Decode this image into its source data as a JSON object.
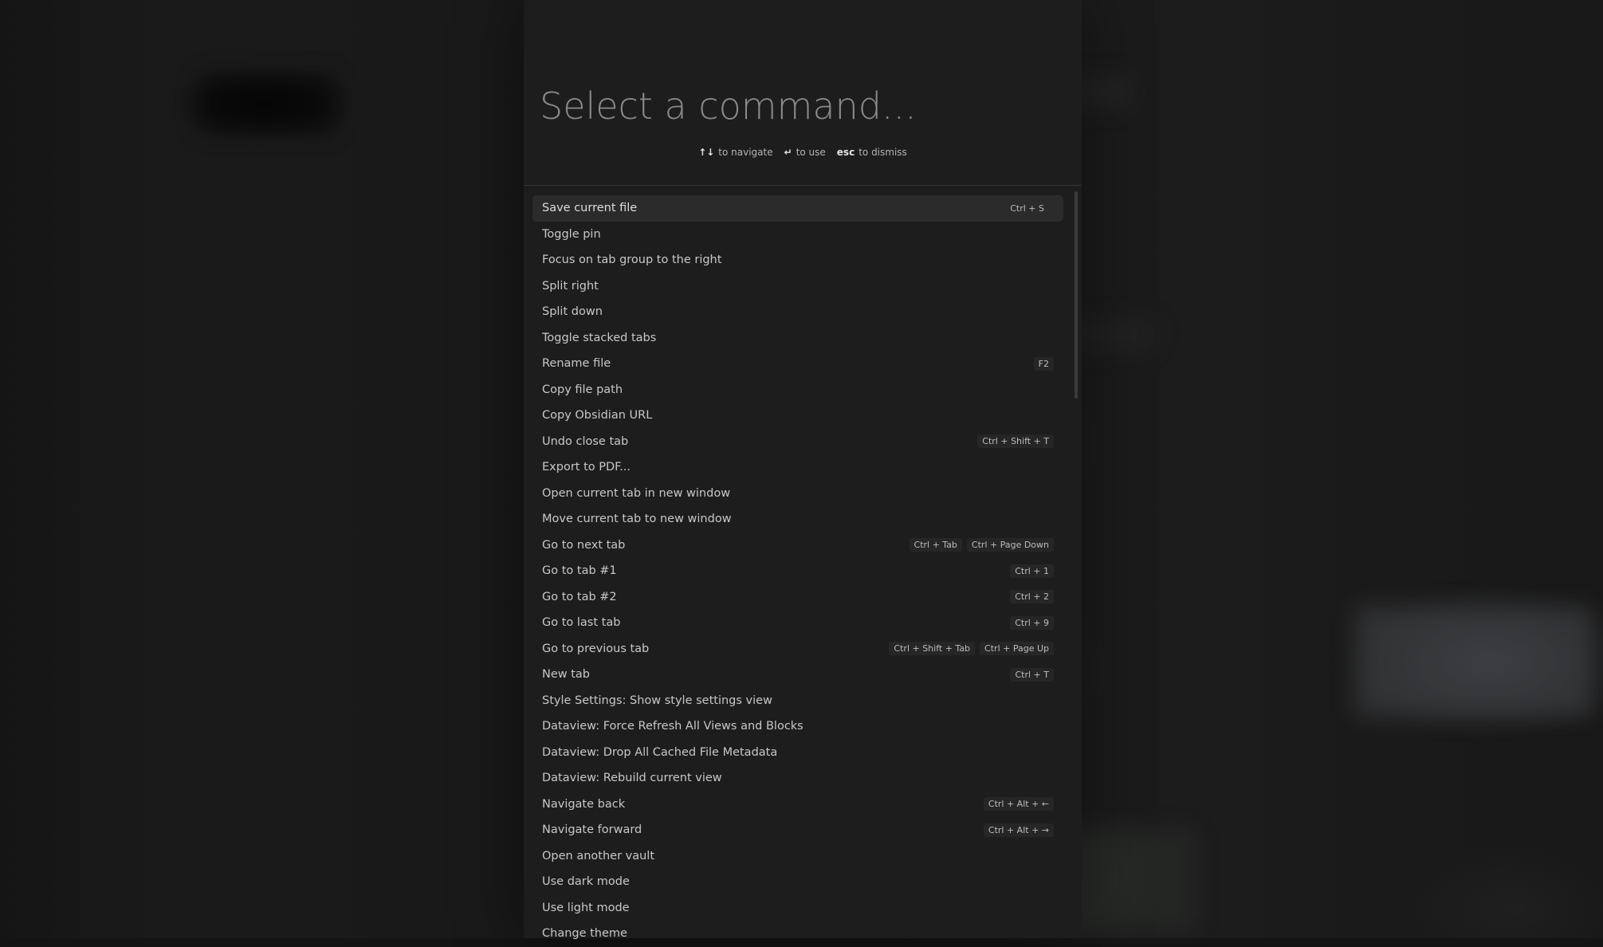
{
  "prompt": {
    "placeholder": "Select a command...",
    "value": ""
  },
  "instructions": [
    {
      "key": "↑↓",
      "text": "to navigate"
    },
    {
      "key": "↵",
      "text": "to use"
    },
    {
      "key": "esc",
      "text": "to dismiss"
    }
  ],
  "commands": [
    {
      "label": "Save current file",
      "hotkeys": [
        "Ctrl + S"
      ],
      "selected": true
    },
    {
      "label": "Toggle pin",
      "hotkeys": []
    },
    {
      "label": "Focus on tab group to the right",
      "hotkeys": []
    },
    {
      "label": "Split right",
      "hotkeys": []
    },
    {
      "label": "Split down",
      "hotkeys": []
    },
    {
      "label": "Toggle stacked tabs",
      "hotkeys": []
    },
    {
      "label": "Rename file",
      "hotkeys": [
        "F2"
      ]
    },
    {
      "label": "Copy file path",
      "hotkeys": []
    },
    {
      "label": "Copy Obsidian URL",
      "hotkeys": []
    },
    {
      "label": "Undo close tab",
      "hotkeys": [
        "Ctrl + Shift + T"
      ]
    },
    {
      "label": "Export to PDF...",
      "hotkeys": []
    },
    {
      "label": "Open current tab in new window",
      "hotkeys": []
    },
    {
      "label": "Move current tab to new window",
      "hotkeys": []
    },
    {
      "label": "Go to next tab",
      "hotkeys": [
        "Ctrl + Tab",
        "Ctrl + Page Down"
      ]
    },
    {
      "label": "Go to tab #1",
      "hotkeys": [
        "Ctrl + 1"
      ]
    },
    {
      "label": "Go to tab #2",
      "hotkeys": [
        "Ctrl + 2"
      ]
    },
    {
      "label": "Go to last tab",
      "hotkeys": [
        "Ctrl + 9"
      ]
    },
    {
      "label": "Go to previous tab",
      "hotkeys": [
        "Ctrl + Shift + Tab",
        "Ctrl + Page Up"
      ]
    },
    {
      "label": "New tab",
      "hotkeys": [
        "Ctrl + T"
      ]
    },
    {
      "label": "Style Settings: Show style settings view",
      "hotkeys": []
    },
    {
      "label": "Dataview: Force Refresh All Views and Blocks",
      "hotkeys": []
    },
    {
      "label": "Dataview: Drop All Cached File Metadata",
      "hotkeys": []
    },
    {
      "label": "Dataview: Rebuild current view",
      "hotkeys": []
    },
    {
      "label": "Navigate back",
      "hotkeys": [
        "Ctrl + Alt + ←"
      ]
    },
    {
      "label": "Navigate forward",
      "hotkeys": [
        "Ctrl + Alt + →"
      ]
    },
    {
      "label": "Open another vault",
      "hotkeys": []
    },
    {
      "label": "Use dark mode",
      "hotkeys": []
    },
    {
      "label": "Use light mode",
      "hotkeys": []
    },
    {
      "label": "Change theme",
      "hotkeys": []
    }
  ],
  "colors": {
    "background": "#141414",
    "modal": "#1d1d1d",
    "selected_row": "#2b2b2b",
    "text": "#c8c8c8"
  }
}
